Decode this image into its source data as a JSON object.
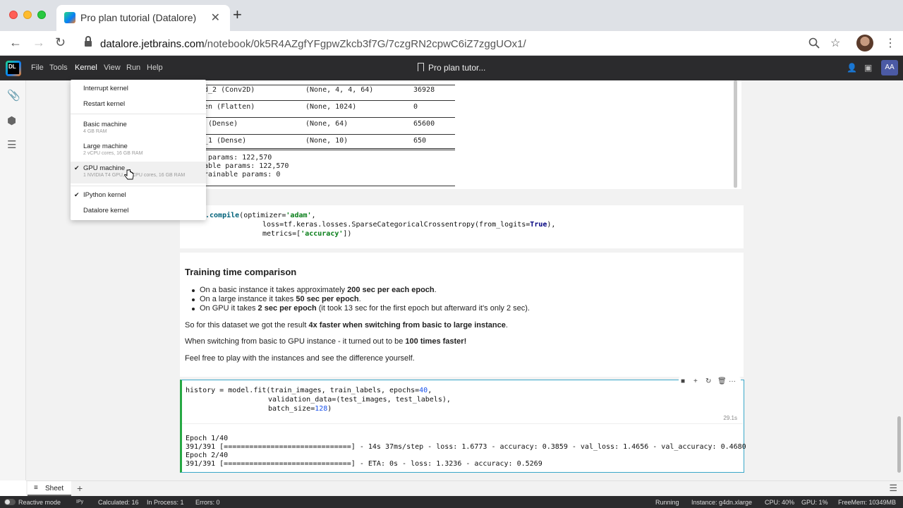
{
  "browser": {
    "tab_title": "Pro plan tutorial (Datalore)",
    "url_host": "datalore.jetbrains.com",
    "url_path": "/notebook/0k5R4AZgfYFgpwZkcb3f7G/7czgRN2cpwC6iZ7zggUOx1/"
  },
  "app": {
    "logo": "DL",
    "menus": [
      "File",
      "Tools",
      "Kernel",
      "View",
      "Run",
      "Help"
    ],
    "doc_title": "Pro plan tutor...",
    "avatar": "AA"
  },
  "kernel_menu": {
    "interrupt": "Interrupt kernel",
    "restart": "Restart kernel",
    "basic": {
      "label": "Basic machine",
      "sub": "4 GB RAM"
    },
    "large": {
      "label": "Large machine",
      "sub": "2 vCPU cores, 16 GB RAM"
    },
    "gpu": {
      "label": "GPU machine",
      "sub": "1 NVIDIA T4 GPU, 4 vCPU cores, 16 GB RAM",
      "check": "✔"
    },
    "ipython": {
      "label": "IPython kernel",
      "check": "✔"
    },
    "datalore": "Datalore kernel"
  },
  "summary": {
    "rows": [
      {
        "layer": "d_2 (Conv2D)",
        "shape": "(None, 4, 4, 64)",
        "params": "36928"
      },
      {
        "layer": "en (Flatten)",
        "shape": "(None, 1024)",
        "params": "0"
      },
      {
        "layer": " (Dense)",
        "shape": "(None, 64)",
        "params": "65600"
      },
      {
        "layer": "_1 (Dense)",
        "shape": "(None, 10)",
        "params": "650"
      }
    ],
    "total": " params: 122,570",
    "trainable": "able params: 122,570",
    "nontrainable": "rainable params: 0"
  },
  "compile_cell": {
    "line1_fn": ".compile",
    "line1_a": "(optimizer=",
    "line1_str": "'adam'",
    "line1_b": ",",
    "line2_a": "loss=tf.keras.losses.SparseCategoricalCrossentropy(from_logits=",
    "line2_kw": "True",
    "line2_b": "),",
    "line3_a": "metrics=[",
    "line3_str": "'accuracy'",
    "line3_b": "])"
  },
  "markdown": {
    "heading": "Training time comparison",
    "b1_pre": "On a basic instance it takes approximately ",
    "b1_bold": "200 sec per each epoch",
    "b1_post": ".",
    "b2_pre": "On a large instance it takes ",
    "b2_bold": "50 sec per epoch",
    "b2_post": ".",
    "b3_pre": "On GPU it takes ",
    "b3_bold": "2 sec per epoch",
    "b3_post": " (it took 13 sec for the first epoch but afterward it's only 2 sec).",
    "p1_pre": "So for this dataset we got the result ",
    "p1_bold": "4x faster when switching from basic to large instance",
    "p1_post": ".",
    "p2_pre": "When switching from basic to GPU instance - it turned out to be ",
    "p2_bold": "100 times faster!",
    "p3": "Feel free to play with the instances and see the difference yourself."
  },
  "fit_cell": {
    "line1_a": "history = model.fit(train_images, train_labels, epochs=",
    "line1_num": "40",
    "line1_b": ",",
    "line2": "validation_data=(test_images, test_labels),",
    "line3_a": "batch_size=",
    "line3_num": "128",
    "line3_b": ")",
    "runtime": "29.1s",
    "output": [
      "Epoch 1/40",
      "391/391 [==============================] - 14s 37ms/step - loss: 1.6773 - accuracy: 0.3859 - val_loss: 1.4656 - val_accuracy: 0.4680",
      "Epoch 2/40",
      "391/391 [==============================] - ETA: 0s - loss: 1.3236 - accuracy: 0.5269"
    ]
  },
  "sheet": {
    "tab": "Sheet",
    "add": "+"
  },
  "status": {
    "reactive": "Reactive mode",
    "kernel_badge": "IPy",
    "calculated": "Calculated: 16",
    "in_process": "In Process: 1",
    "errors": "Errors: 0",
    "state": "Running",
    "instance": "Instance: g4dn.xlarge",
    "cpu": "CPU:  40%",
    "gpu": "GPU:    1%",
    "freemem": "FreeMem:  10349MB"
  },
  "icons": [
    "search-icon",
    "star-icon",
    "back-icon",
    "forward-icon",
    "reload-icon",
    "lock-icon",
    "kebab-icon",
    "paperclip-icon",
    "box-icon",
    "list-icon",
    "bookmark-icon",
    "stop-icon",
    "plus-icon",
    "refresh-icon",
    "trash-icon",
    "more-icon",
    "hamburger-icon",
    "hand-cursor-icon"
  ]
}
